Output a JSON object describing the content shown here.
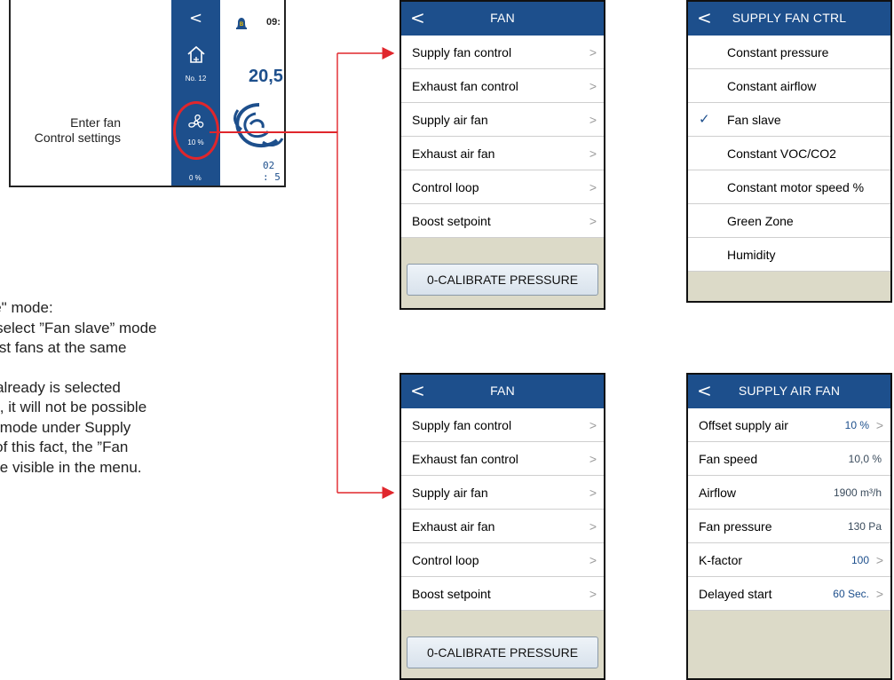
{
  "thumbnail": {
    "label_line1": "Enter fan",
    "label_line2": "Control settings",
    "back_glyph": "<",
    "home_icon": "home-icon",
    "home_label": "No. 12",
    "fan_icon": "fan-icon",
    "fan_percent": "10 %",
    "bottom_value": "0 %",
    "bell_letter": "B",
    "time": "09:",
    "temperature": "20,5",
    "timer": "02 : 5",
    "highlight_color": "#e0262c"
  },
  "note": {
    "lines": [
      "slave\" mode:",
      "e to select ”Fan slave” mode",
      "xhaust fans at the same",
      "",
      "ode already is selected",
      "ir fan, it will not be possible",
      "ave” mode under Supply",
      "use of this fact, the ”Fan",
      " not be visible in the menu."
    ]
  },
  "fan_menu_top": {
    "title": "FAN",
    "items": [
      "Supply fan control",
      "Exhaust fan control",
      "Supply air fan",
      "Exhaust air fan",
      "Control loop",
      "Boost setpoint"
    ],
    "button": "0-CALIBRATE PRESSURE"
  },
  "supply_fan_ctrl": {
    "title": "SUPPLY FAN CTRL",
    "items": [
      "Constant pressure",
      "Constant airflow",
      "Fan slave",
      "Constant VOC/CO2",
      "Constant motor speed %",
      "Green Zone",
      "Humidity"
    ],
    "selected_index": 2
  },
  "fan_menu_bottom": {
    "title": "FAN",
    "items": [
      "Supply fan control",
      "Exhaust fan control",
      "Supply air fan",
      "Exhaust air fan",
      "Control loop",
      "Boost setpoint"
    ],
    "button": "0-CALIBRATE PRESSURE"
  },
  "supply_air_fan": {
    "title": "SUPPLY AIR FAN",
    "rows": [
      {
        "label": "Offset supply air",
        "value": "10 %"
      },
      {
        "label": "Fan speed",
        "value": "10,0 %"
      },
      {
        "label": "Airflow",
        "value": "1900 m³/h"
      },
      {
        "label": "Fan pressure",
        "value": "130 Pa"
      },
      {
        "label": "K-factor",
        "value": "100"
      },
      {
        "label": "Delayed start",
        "value": "60 Sec."
      }
    ]
  },
  "colors": {
    "header_blue": "#1d4f8c",
    "arrow_red": "#e0262c",
    "footer_beige": "#dcdac8"
  }
}
